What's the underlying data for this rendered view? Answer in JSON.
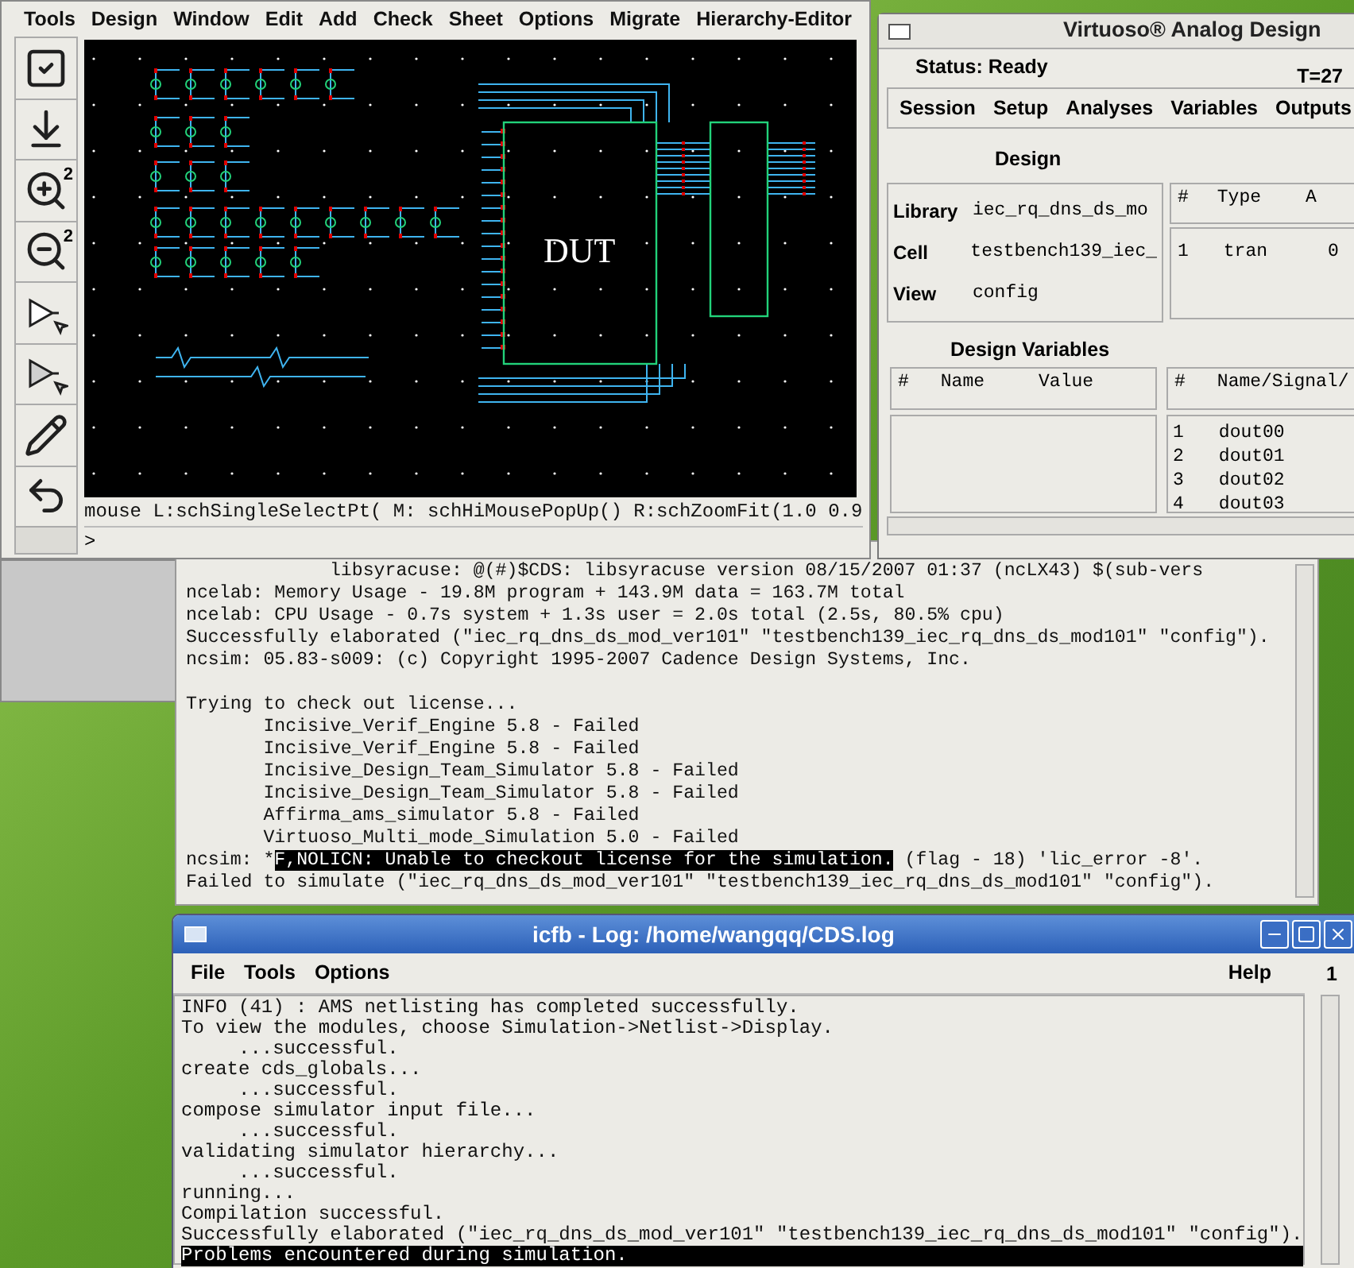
{
  "schematic_window": {
    "menu": [
      "Tools",
      "Design",
      "Window",
      "Edit",
      "Add",
      "Check",
      "Sheet",
      "Options",
      "Migrate",
      "Hierarchy-Editor"
    ],
    "toolbar": [
      {
        "kind": "check"
      },
      {
        "kind": "save"
      },
      {
        "kind": "zoom_in",
        "label": "2"
      },
      {
        "kind": "zoom_out",
        "label": "2"
      },
      {
        "kind": "select"
      },
      {
        "kind": "select_area"
      },
      {
        "kind": "pencil"
      },
      {
        "kind": "undo"
      }
    ],
    "block_label": "DUT",
    "mouse_status": "mouse L:schSingleSelectPt( M: schHiMousePopUp() R:schZoomFit(1.0 0.9",
    "prompt": ">"
  },
  "analog_window": {
    "title": "Virtuoso® Analog Design",
    "status": "Status: Ready",
    "temperature": "T=27",
    "menu": [
      "Session",
      "Setup",
      "Analyses",
      "Variables",
      "Outputs"
    ],
    "design_heading": "Design",
    "design": [
      {
        "label": "Library",
        "value": "iec_rq_dns_ds_mo"
      },
      {
        "label": "Cell",
        "value": "testbench139_iec_"
      },
      {
        "label": "View",
        "value": "config"
      }
    ],
    "analyses": {
      "columns": [
        "#",
        "Type",
        "A"
      ],
      "rows": [
        [
          "1",
          "tran",
          "0"
        ]
      ]
    },
    "variables_heading": "Design Variables",
    "variables": {
      "columns": [
        "#",
        "Name",
        "Value"
      ]
    },
    "outputs": {
      "columns": [
        "#",
        "Name/Signal/"
      ],
      "rows": [
        [
          "1",
          "dout00"
        ],
        [
          "2",
          "dout01"
        ],
        [
          "3",
          "dout02"
        ],
        [
          "4",
          "dout03"
        ]
      ]
    }
  },
  "console": {
    "lines": [
      {
        "text": "             libsyracuse: @(#)$CDS: libsyracuse version 08/15/2007 01:37 (ncLX43) $(sub-vers"
      },
      {
        "text": "ncelab: Memory Usage - 19.8M program + 143.9M data = 163.7M total"
      },
      {
        "text": "ncelab: CPU Usage - 0.7s system + 1.3s user = 2.0s total (2.5s, 80.5% cpu)"
      },
      {
        "text": "Successfully elaborated (\"iec_rq_dns_ds_mod_ver101\" \"testbench139_iec_rq_dns_ds_mod101\" \"config\")."
      },
      {
        "text": "ncsim: 05.83-s009: (c) Copyright 1995-2007 Cadence Design Systems, Inc."
      },
      {
        "text": "Trying to check out license...",
        "gap_before": true
      },
      {
        "text": "       Incisive_Verif_Engine 5.8 - Failed"
      },
      {
        "text": "       Incisive_Verif_Engine 5.8 - Failed"
      },
      {
        "text": "       Incisive_Design_Team_Simulator 5.8 - Failed"
      },
      {
        "text": "       Incisive_Design_Team_Simulator 5.8 - Failed"
      },
      {
        "text": "       Affirma_ams_simulator 5.8 - Failed"
      },
      {
        "text": "       Virtuoso_Multi_mode_Simulation 5.0 - Failed"
      },
      {
        "text": "ncsim: *",
        "highlight": "F,NOLICN: Unable to checkout license for the simulation.",
        "rest": " (flag - 18) 'lic_error -8'."
      },
      {
        "text": "Failed to simulate (\"iec_rq_dns_ds_mod_ver101\" \"testbench139_iec_rq_dns_ds_mod101\" \"config\")."
      }
    ]
  },
  "log_window": {
    "title": "icfb - Log: /home/wangqq/CDS.log",
    "menu": [
      "File",
      "Tools",
      "Options"
    ],
    "help": "Help",
    "counter": "1",
    "lines": [
      {
        "text": "INFO (41) : AMS netlisting has completed successfully.",
        "selected": false
      },
      {
        "text": "To view the modules, choose Simulation->Netlist->Display.",
        "selected": false
      },
      {
        "text": "     ...successful.",
        "selected": false
      },
      {
        "text": "create cds_globals...",
        "selected": false
      },
      {
        "text": "     ...successful.",
        "selected": false
      },
      {
        "text": "compose simulator input file...",
        "selected": false
      },
      {
        "text": "     ...successful.",
        "selected": false
      },
      {
        "text": "validating simulator hierarchy...",
        "selected": false
      },
      {
        "text": "     ...successful.",
        "selected": false
      },
      {
        "text": "running...",
        "selected": false
      },
      {
        "text": "Compilation successful.",
        "selected": false
      },
      {
        "text": "Successfully elaborated (\"iec_rq_dns_ds_mod_ver101\" \"testbench139_iec_rq_dns_ds_mod101\" \"config\").",
        "selected": false
      },
      {
        "text": "Problems encountered during simulation.",
        "selected": true
      }
    ]
  }
}
